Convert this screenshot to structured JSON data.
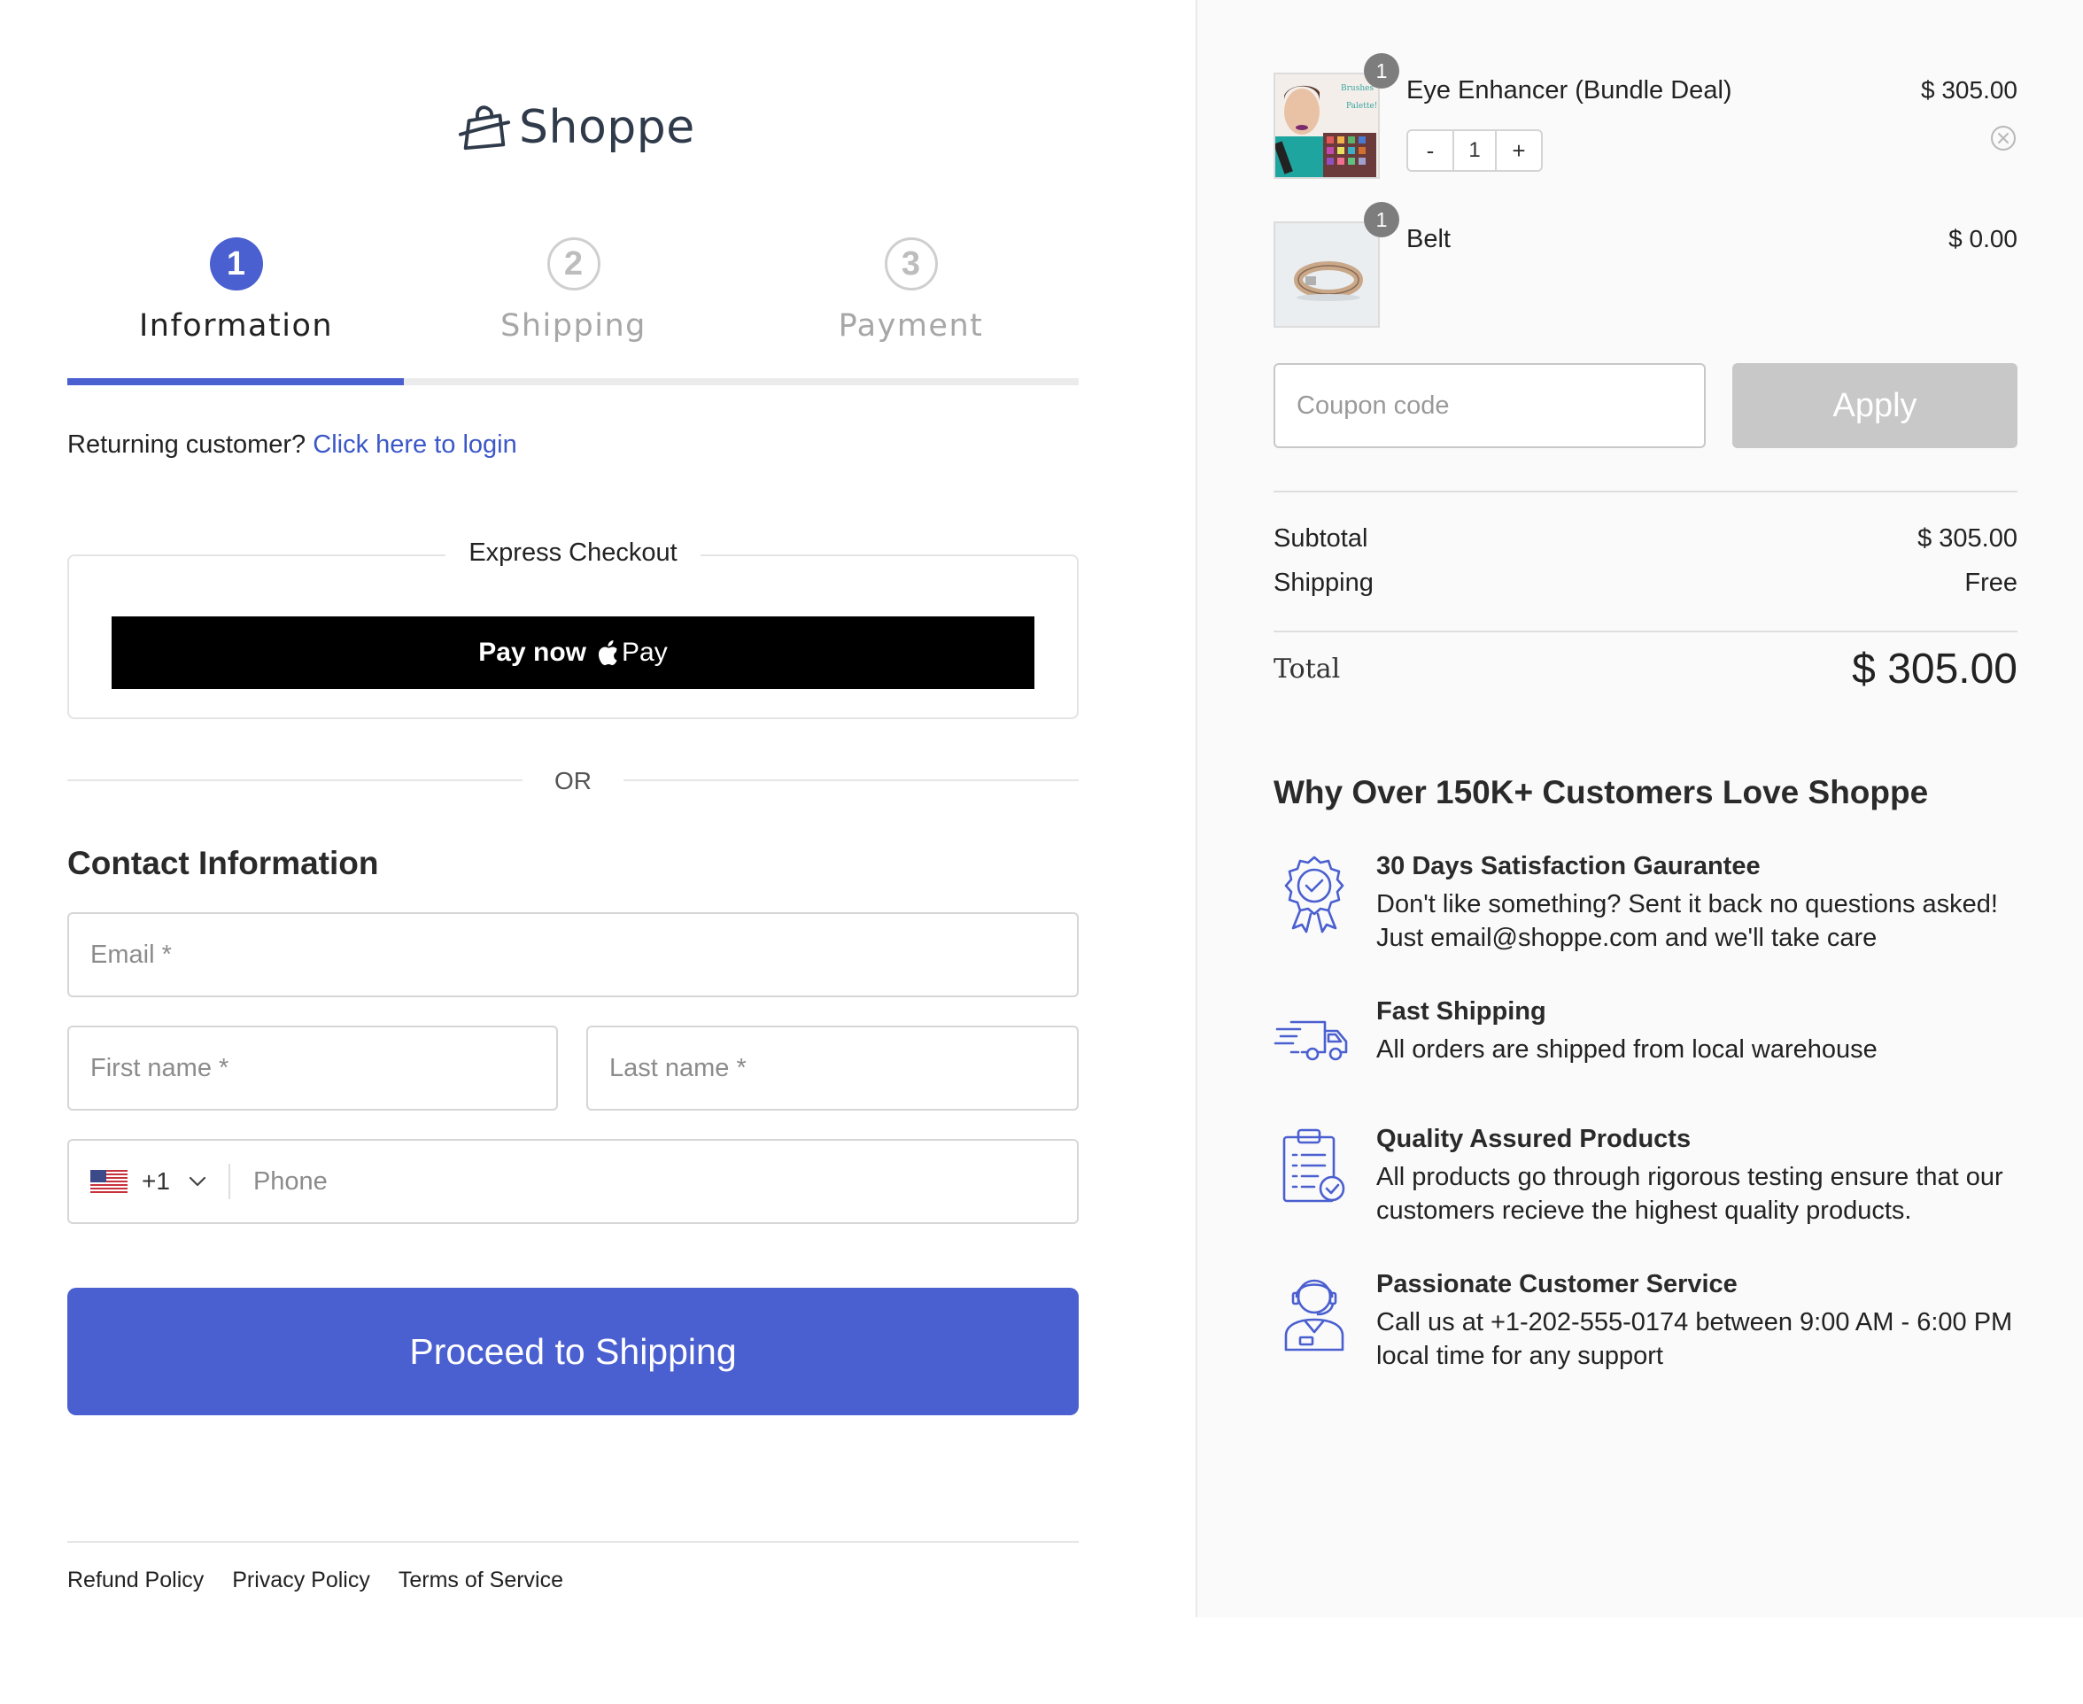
{
  "brand": {
    "name": "Shoppe",
    "accent": "#4a5fd0"
  },
  "steps": [
    {
      "number": "1",
      "label": "Information",
      "state": "active"
    },
    {
      "number": "2",
      "label": "Shipping",
      "state": "inactive"
    },
    {
      "number": "3",
      "label": "Payment",
      "state": "inactive"
    }
  ],
  "progress_fraction": 0.333,
  "returning": {
    "text": "Returning customer?",
    "link": "Click here to login"
  },
  "express": {
    "legend": "Express Checkout",
    "paynow": "Pay now",
    "apple_pay": "Pay"
  },
  "or_text": "OR",
  "contact": {
    "title": "Contact Information",
    "email_placeholder": "Email *",
    "first_name_placeholder": "First name *",
    "last_name_placeholder": "Last name *",
    "phone_dial": "+1",
    "phone_placeholder": "Phone",
    "phone_country_flag": "us-flag-icon"
  },
  "proceed_button": "Proceed to Shipping",
  "footer": {
    "refund": "Refund Policy",
    "privacy": "Privacy Policy",
    "terms": "Terms of Service"
  },
  "cart": {
    "items": [
      {
        "name": "Eye Enhancer (Bundle Deal)",
        "price": "$ 305.00",
        "badge": "1",
        "qty": "1",
        "decrement": "-",
        "increment": "+"
      },
      {
        "name": "Belt",
        "price": "$ 0.00",
        "badge": "1"
      }
    ],
    "coupon_placeholder": "Coupon code",
    "apply_label": "Apply",
    "subtotal_label": "Subtotal",
    "subtotal_value": "$ 305.00",
    "shipping_label": "Shipping",
    "shipping_value": "Free",
    "total_label": "Total",
    "total_value": "$ 305.00"
  },
  "why": {
    "title": "Why Over 150K+ Customers Love Shoppe",
    "benefits": [
      {
        "icon": "award-badge-icon",
        "title": "30 Days Satisfaction Gaurantee",
        "desc": "Don't like something? Sent it back no questions asked! Just email@shoppe.com and we'll take care"
      },
      {
        "icon": "delivery-truck-icon",
        "title": "Fast Shipping",
        "desc": "All orders are shipped from local warehouse"
      },
      {
        "icon": "clipboard-check-icon",
        "title": "Quality Assured Products",
        "desc": "All products go through rigorous testing ensure that our customers recieve the highest quality products."
      },
      {
        "icon": "support-agent-icon",
        "title": "Passionate Customer Service",
        "desc": "Call us at +1-202-555-0174 between 9:00 AM - 6:00 PM local time for any support"
      }
    ]
  }
}
